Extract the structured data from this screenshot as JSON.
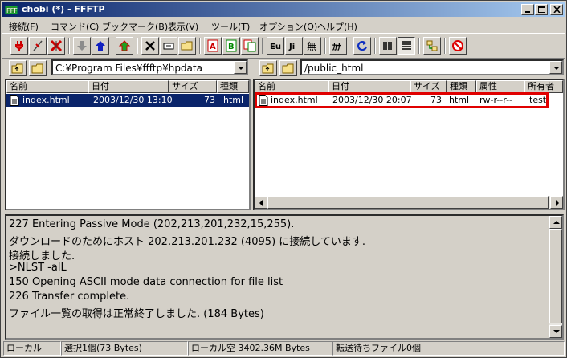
{
  "window": {
    "title": "chobi (*) - FFFTP"
  },
  "menu": [
    "接続(F)",
    "コマンド(C)",
    "ブックマーク(B)",
    "表示(V)",
    "ツール(T)",
    "オプション(O)",
    "ヘルプ(H)"
  ],
  "local": {
    "path": "C:¥Program Files¥ffftp¥hpdata",
    "headers": {
      "name": "名前",
      "date": "日付",
      "size": "サイズ",
      "type": "種類"
    },
    "files": [
      {
        "name": "index.html",
        "date": "2003/12/30 13:10",
        "size": "73",
        "type": "html"
      }
    ]
  },
  "remote": {
    "path": "/public_html",
    "headers": {
      "name": "名前",
      "date": "日付",
      "size": "サイズ",
      "type": "種類",
      "attr": "属性",
      "owner": "所有者"
    },
    "files": [
      {
        "name": "index.html",
        "date": "2003/12/30 20:07",
        "size": "73",
        "type": "html",
        "attr": "rw-r--r--",
        "owner": "test"
      }
    ]
  },
  "log": [
    "227 Entering Passive Mode (202,213,201,232,15,255).",
    "ダウンロードのためにホスト 202.213.201.232 (4095) に接続しています.",
    "接続しました.",
    ">NLST -alL",
    "150 Opening ASCII mode data connection for file list",
    "226 Transfer complete.",
    "ファイル一覧の取得は正常終了しました. (184 Bytes)"
  ],
  "status": {
    "mode": "ローカル",
    "selection": "選択1個(73 Bytes)",
    "free": "ローカル空 3402.36M Bytes",
    "queue": "転送待ちファイル0個"
  },
  "toolbar_icons": [
    "connect-icon",
    "quick-connect-icon",
    "disconnect-icon",
    "download-icon",
    "upload-icon",
    "mirror-upload-icon",
    "delete-icon",
    "rename-icon",
    "mkdir-icon",
    "ascii-mode-icon",
    "binary-mode-icon",
    "auto-mode-icon",
    "euc-convert-icon",
    "jis-convert-icon",
    "no-convert-icon",
    "kana-convert-icon",
    "refresh-icon",
    "list-view-icon",
    "detail-view-icon",
    "sync-folder-icon",
    "stop-icon"
  ],
  "colors": {
    "highlight": "#e00000",
    "titlebar": "#0a246a",
    "selection": "#0a246a"
  }
}
